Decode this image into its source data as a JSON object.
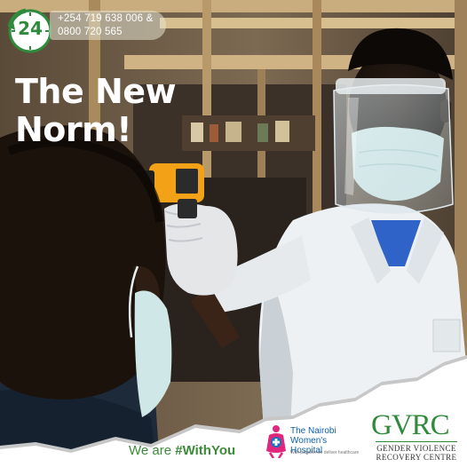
{
  "badge": {
    "number": "24",
    "icon": "24-hour-clock-icon",
    "color": "#2f8a3b"
  },
  "contact": {
    "phone_primary": "+254 719 638 006 &",
    "phone_secondary": "0800 720 565"
  },
  "headline": {
    "line1": "The New",
    "line2": "Norm!"
  },
  "tagline": {
    "prefix": "We are ",
    "hashtag": "#WithYou"
  },
  "partners": {
    "nwh": {
      "name": "The Nairobi Women's Hospital",
      "slogan": "With passion we deliver healthcare",
      "icon": "woman-hospital-logo-icon",
      "color": "#0f5fa8"
    },
    "gvrc": {
      "mark": "GVRC",
      "line1": "GENDER VIOLENCE",
      "line2": "RECOVERY CENTRE",
      "color": "#2e8b3a"
    }
  },
  "colors": {
    "accent_green": "#3c8a3a",
    "headline": "#ffffff",
    "footer_background": "#ffffff"
  }
}
